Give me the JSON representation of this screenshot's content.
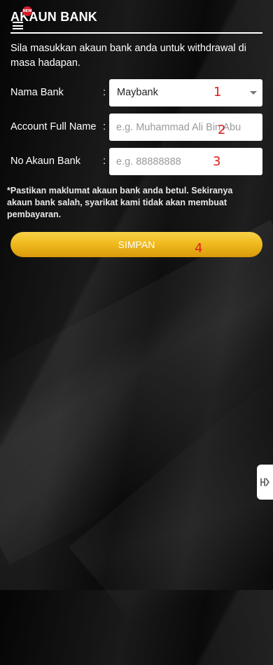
{
  "header": {
    "title": "AKAUN BANK",
    "new_badge": "NEW"
  },
  "intro_text": "Sila masukkan akaun bank anda untuk withdrawal di masa hadapan.",
  "form": {
    "bank": {
      "label": "Nama Bank",
      "colon": ":",
      "selected": "Maybank",
      "marker": "1"
    },
    "full_name": {
      "label": "Account Full Name",
      "colon": ":",
      "placeholder": "e.g. Muhammad Ali Bin Abu",
      "value": "",
      "marker": "2"
    },
    "account_no": {
      "label": "No Akaun Bank",
      "colon": ":",
      "placeholder": "e.g. 88888888",
      "value": "",
      "marker": "3"
    }
  },
  "notice": "*Pastikan maklumat akaun bank anda betul. Sekiranya akaun bank salah, syarikat kami tidak akan membuat pembayaran.",
  "save_button": {
    "label": "SIMPAN",
    "marker": "4"
  },
  "colors": {
    "button_gold": "#f0bb1f",
    "badge_red": "#d21f2b",
    "marker_red": "#e11b1b"
  },
  "icons": {
    "menu": "hamburger-menu-icon",
    "dropdown": "caret-down-icon",
    "side": "side-tab-icon"
  }
}
